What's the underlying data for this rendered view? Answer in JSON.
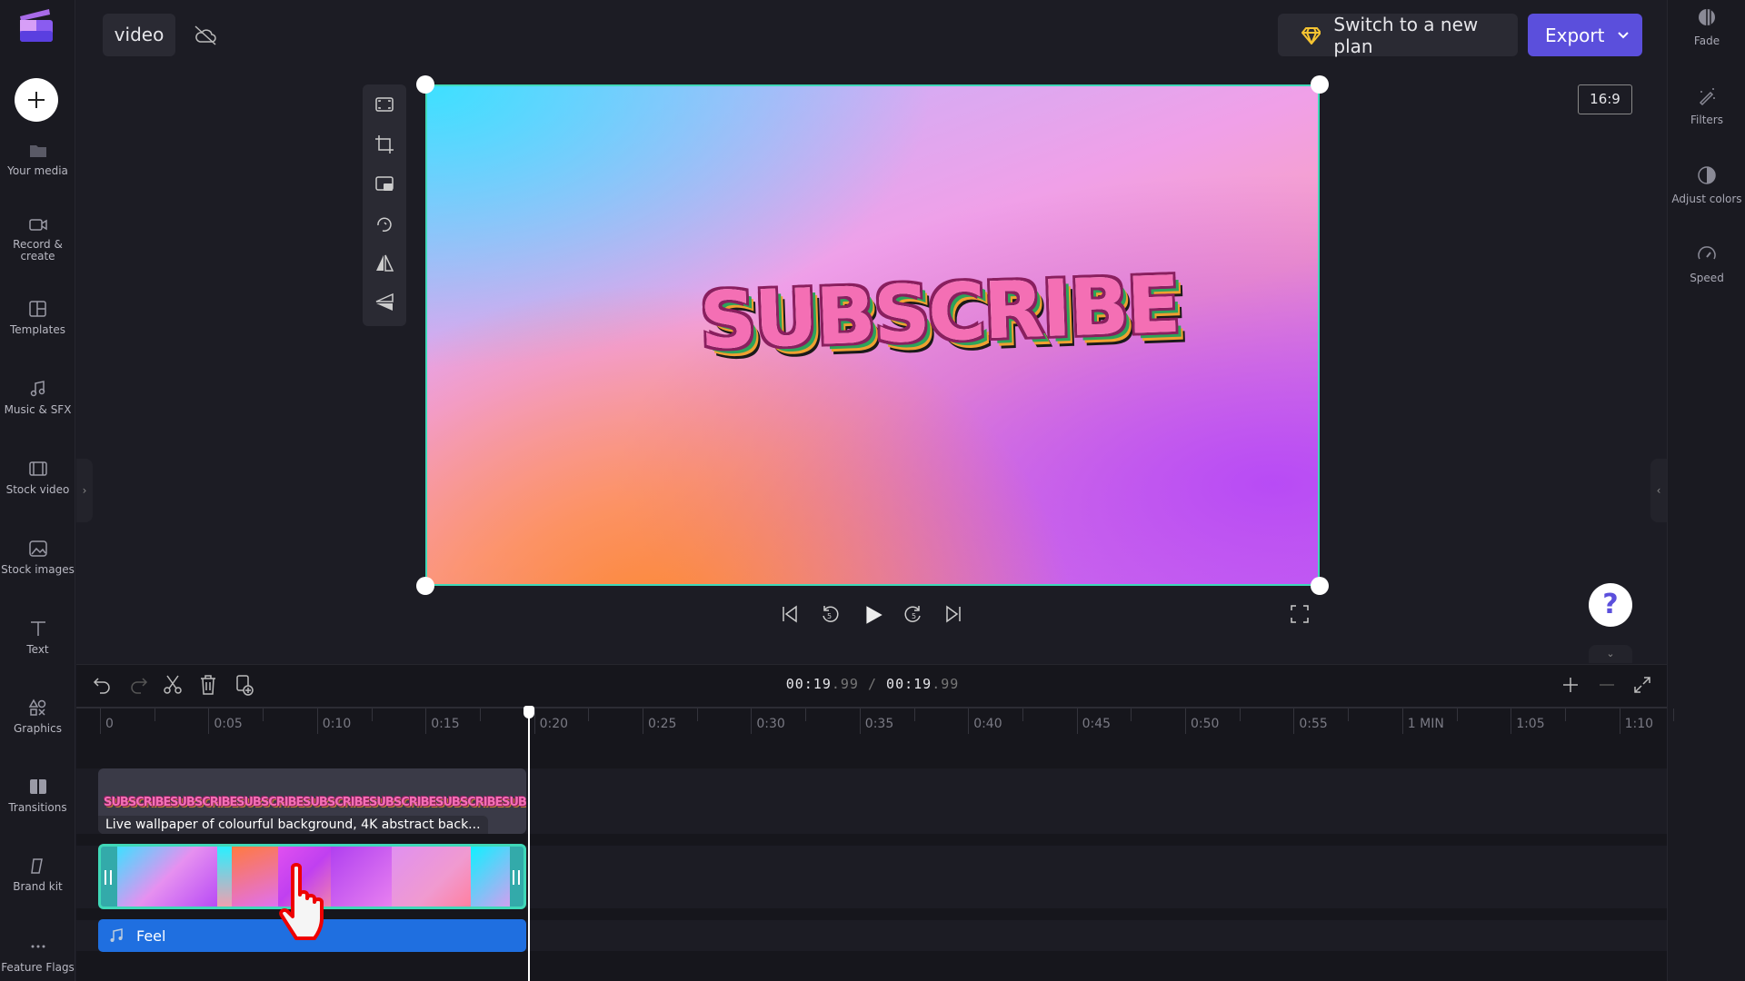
{
  "header": {
    "project_name": "video",
    "cloud_status_icon": "cloud-off-icon",
    "upgrade_label": "Switch to a new plan",
    "export_label": "Export"
  },
  "sidebar": {
    "items": [
      {
        "label": "Your media",
        "icon": "folder-icon"
      },
      {
        "label": "Record &\ncreate",
        "icon": "camera-icon"
      },
      {
        "label": "Templates",
        "icon": "templates-icon"
      },
      {
        "label": "Music & SFX",
        "icon": "music-icon"
      },
      {
        "label": "Stock video",
        "icon": "film-icon"
      },
      {
        "label": "Stock images",
        "icon": "image-icon"
      },
      {
        "label": "Text",
        "icon": "text-icon"
      },
      {
        "label": "Graphics",
        "icon": "shapes-icon"
      },
      {
        "label": "Transitions",
        "icon": "transitions-icon"
      },
      {
        "label": "Brand kit",
        "icon": "brand-icon"
      },
      {
        "label": "Feature Flags",
        "icon": "more-icon"
      }
    ]
  },
  "right_panel": {
    "items": [
      {
        "label": "Fade"
      },
      {
        "label": "Filters"
      },
      {
        "label": "Adjust colors"
      },
      {
        "label": "Speed"
      }
    ]
  },
  "preview": {
    "aspect_ratio": "16:9",
    "sticker_text": "SUBSCRIBE"
  },
  "timeline": {
    "current_time": "00:19",
    "current_frac": ".99",
    "total_time": "00:19",
    "total_frac": ".99",
    "ruler": [
      "0",
      "0:05",
      "0:10",
      "0:15",
      "0:20",
      "0:25",
      "0:30",
      "0:35",
      "0:40",
      "0:45",
      "0:50",
      "0:55",
      "1 MIN",
      "1:05",
      "1:10"
    ],
    "text_clip": {
      "label": "SUBSCRIBE",
      "title": "Live wallpaper of colourful background, 4K abstract back..."
    },
    "audio_clip": {
      "label": "Feel"
    }
  },
  "colors": {
    "accent": "#5b4fdc",
    "selection": "#3fd8b8",
    "audio": "#1f6fe0",
    "upgrade_icon": "#f6c431"
  }
}
